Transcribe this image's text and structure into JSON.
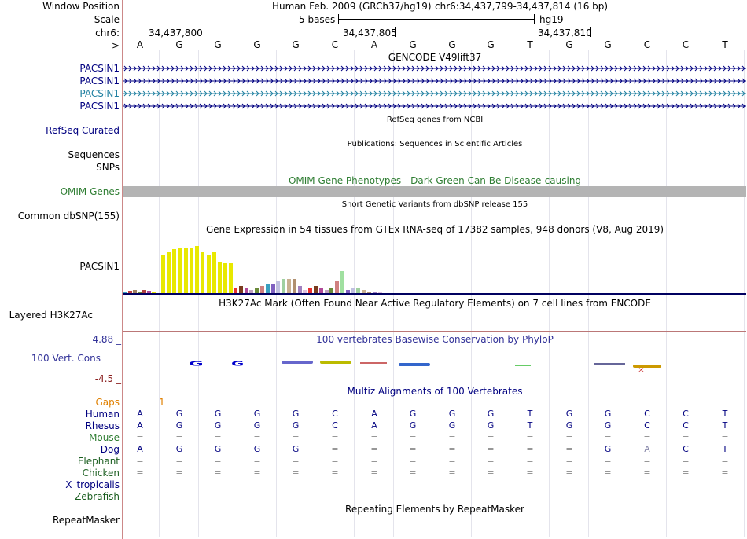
{
  "labels": {
    "window_position": "Window Position",
    "scale": "Scale",
    "chrom": "chr6:",
    "strand": "--->",
    "pacsin1": "PACSIN1",
    "refseq": "RefSeq Curated",
    "sequences": "Sequences",
    "snps": "SNPs",
    "omim": "OMIM Genes",
    "dbsnp": "Common dbSNP(155)",
    "gtex": "PACSIN1",
    "h3k27ac": "Layered H3K27Ac",
    "cons": "100 Vert. Cons",
    "cons_max": "4.88 _",
    "cons_min": "-4.5 _",
    "gaps": "Gaps",
    "repeatmasker": "RepeatMasker"
  },
  "header": {
    "assembly": "Human Feb. 2009 (GRCh37/hg19)",
    "position": "chr6:34,437,799-34,437,814 (16 bp)",
    "scale_text": "5 bases",
    "scale_db": "hg19",
    "coords": [
      "34,437,800",
      "34,437,805",
      "34,437,810"
    ]
  },
  "bases": [
    "A",
    "G",
    "G",
    "G",
    "G",
    "C",
    "A",
    "G",
    "G",
    "G",
    "T",
    "G",
    "G",
    "C",
    "C",
    "T"
  ],
  "titles": {
    "gencode": "GENCODE V49lift37",
    "refseq": "RefSeq genes from NCBI",
    "publications": "Publications: Sequences in Scientific Articles",
    "omim": "OMIM Gene Phenotypes - Dark Green Can Be Disease-causing",
    "dbsnp": "Short Genetic Variants from dbSNP release 155",
    "gtex": "Gene Expression in 54 tissues from GTEx RNA-seq of 17382 samples, 948 donors (V8, Aug 2019)",
    "h3k27ac": "H3K27Ac Mark (Often Found Near Active Regulatory Elements) on 7 cell lines from ENCODE",
    "phylop": "100 vertebrates Basewise Conservation by PhyloP",
    "multiz": "Multiz Alignments of 100 Vertebrates",
    "repeatmasker": "Repeating Elements by RepeatMasker"
  },
  "gaps_value": "1",
  "species": [
    {
      "name": "Human",
      "color": "#000080",
      "row": [
        "A",
        "G",
        "G",
        "G",
        "G",
        "C",
        "A",
        "G",
        "G",
        "G",
        "T",
        "G",
        "G",
        "C",
        "C",
        "T"
      ]
    },
    {
      "name": "Rhesus",
      "color": "#000080",
      "row": [
        "A",
        "G",
        "G",
        "G",
        "G",
        "C",
        "A",
        "G",
        "G",
        "G",
        "T",
        "G",
        "G",
        "C",
        "C",
        "T"
      ]
    },
    {
      "name": "Mouse",
      "color": "#2e7d32",
      "row": [
        "=",
        "=",
        "=",
        "=",
        "=",
        "=",
        "=",
        "=",
        "=",
        "=",
        "=",
        "=",
        "=",
        "=",
        "=",
        "="
      ]
    },
    {
      "name": "Dog",
      "color": "#000080",
      "row": [
        "A",
        "G",
        "G",
        "G",
        "G",
        "=",
        "=",
        "=",
        "=",
        "=",
        "=",
        "=",
        "G",
        "A",
        "C",
        "T"
      ]
    },
    {
      "name": "Elephant",
      "color": "#1b5e20",
      "row": [
        "=",
        "=",
        "=",
        "=",
        "=",
        "=",
        "=",
        "=",
        "=",
        "=",
        "=",
        "=",
        "=",
        "=",
        "=",
        "="
      ]
    },
    {
      "name": "Chicken",
      "color": "#1b5e20",
      "row": [
        "=",
        "=",
        "=",
        "=",
        "=",
        "=",
        "=",
        "=",
        "=",
        "=",
        "=",
        "=",
        "=",
        "=",
        "=",
        "="
      ]
    },
    {
      "name": "X_tropicalis",
      "color": "#000080",
      "row": [
        "",
        "",
        "",
        "",
        "",
        "",
        "",
        "",
        "",
        "",
        "",
        "",
        "",
        "",
        "",
        ""
      ]
    },
    {
      "name": "Zebrafish",
      "color": "#1b5e20",
      "row": [
        "",
        "",
        "",
        "",
        "",
        "",
        "",
        "",
        "",
        "",
        "",
        "",
        "",
        "",
        "",
        ""
      ]
    }
  ],
  "gtex_expression": [
    2,
    2,
    3,
    3,
    2,
    3,
    2,
    0,
    0,
    0,
    0,
    0,
    0,
    0,
    0,
    0,
    0,
    0,
    0,
    0,
    0,
    0,
    0,
    0,
    0,
    0,
    3,
    4,
    3,
    2,
    3,
    4,
    5,
    5,
    7,
    8,
    4,
    3,
    4,
    2,
    3,
    4,
    3,
    2,
    3,
    7,
    3,
    2,
    3,
    3,
    2,
    1,
    1,
    1
  ],
  "gtex_high": [
    48,
    52,
    56,
    58,
    58,
    58,
    60,
    52,
    48,
    52,
    40,
    38,
    38
  ],
  "colors": {
    "nav": "#000080",
    "teal": "#1e7fa0",
    "omim": "#2e7d32",
    "gaps": "#e08000",
    "phylop": "#333399",
    "gtex": "#e8e800"
  }
}
